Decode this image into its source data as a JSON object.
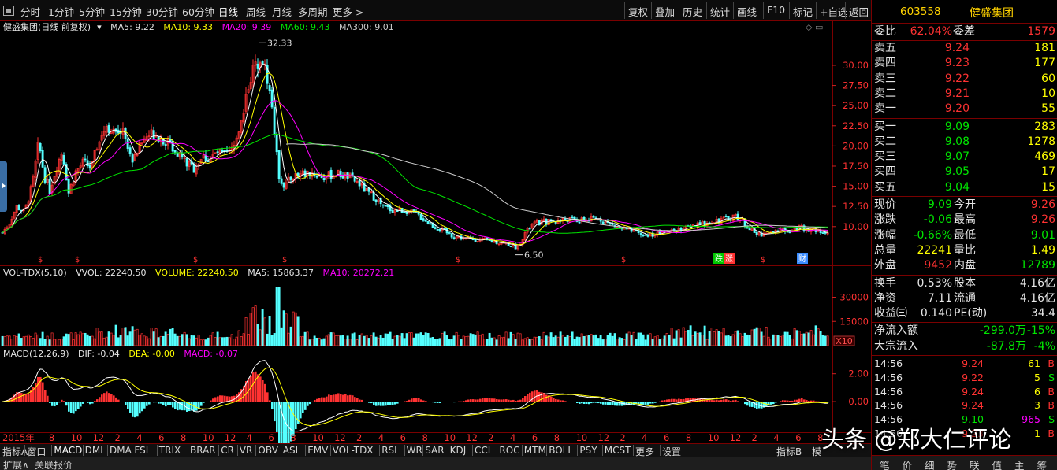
{
  "toolbar": {
    "periods": [
      "分时",
      "1分钟",
      "5分钟",
      "15分钟",
      "30分钟",
      "60分钟",
      "日线",
      "周线",
      "月线",
      "多周期",
      "更多 >"
    ],
    "active_period": "日线",
    "actions": [
      "复权",
      "叠加",
      "历史",
      "统计",
      "画线",
      "F10",
      "标记",
      "+自选",
      "返回"
    ]
  },
  "main_info": {
    "title": "健盛集团(日线 前复权)",
    "ma5": "MA5: 9.22",
    "ma10": "MA10: 9.33",
    "ma20": "MA20: 9.39",
    "ma60": "MA60: 9.43",
    "ma300": "MA300: 9.01"
  },
  "vol_info": {
    "title": "VOL-TDX(5,10)",
    "vvol": "VVOL: 22240.50",
    "volume": "VOLUME: 22240.50",
    "ma5": "MA5: 15863.37",
    "ma10": "MA10: 20272.21"
  },
  "macd_info": {
    "title": "MACD(12,26,9)",
    "dif": "DIF: -0.04",
    "dea": "DEA: -0.00",
    "macd": "MACD: -0.07"
  },
  "colors": {
    "up": "#ff3232",
    "down": "#54ffff",
    "ma5": "#ffffff",
    "ma10": "#ffff00",
    "ma20": "#ff00ff",
    "ma60": "#00e600",
    "ma300": "#cccccc",
    "grid": "#7a0000"
  },
  "chart_data": {
    "type": "candlestick",
    "price_axis": {
      "ticks": [
        30.0,
        27.5,
        25.0,
        22.5,
        20.0,
        17.5,
        15.0,
        12.5,
        10.0
      ],
      "range": [
        5.0,
        34.0
      ]
    },
    "price_annotations": {
      "high": "32.33",
      "low": "6.50"
    },
    "volume_axis": {
      "ticks": [
        30000,
        15000
      ],
      "range": [
        0,
        40000
      ],
      "unit": "X10"
    },
    "macd_axis": {
      "ticks": [
        "2.00",
        "0.00"
      ],
      "range": [
        -2.2,
        3.0
      ]
    },
    "time_labels": [
      "2015年",
      "8",
      "10",
      "12",
      "2",
      "4",
      "6",
      "8",
      "10",
      "12",
      "4",
      "6",
      "8",
      "10",
      "12",
      "2",
      "4",
      "6",
      "8",
      "10",
      "12",
      "2",
      "4",
      "6",
      "8",
      "10",
      "12",
      "2",
      "4",
      "6",
      "8",
      "10",
      "12",
      "2",
      "4",
      "6",
      "8"
    ],
    "markers": [
      "涨",
      "跌",
      "财"
    ],
    "series_points": [
      [
        0,
        9.0
      ],
      [
        10,
        10.3
      ],
      [
        20,
        12.5
      ],
      [
        30,
        11.8
      ],
      [
        40,
        15.2
      ],
      [
        48,
        20.5
      ],
      [
        55,
        16.3
      ],
      [
        62,
        14.5
      ],
      [
        70,
        17.2
      ],
      [
        78,
        19.5
      ],
      [
        86,
        14.2
      ],
      [
        95,
        16.8
      ],
      [
        105,
        18.0
      ],
      [
        115,
        17.2
      ],
      [
        125,
        21.2
      ],
      [
        135,
        22.6
      ],
      [
        145,
        21.3
      ],
      [
        155,
        22.5
      ],
      [
        165,
        18.2
      ],
      [
        175,
        19.8
      ],
      [
        185,
        21.2
      ],
      [
        195,
        21.7
      ],
      [
        205,
        20.9
      ],
      [
        215,
        20.2
      ],
      [
        225,
        19.2
      ],
      [
        235,
        17.9
      ],
      [
        245,
        17.2
      ],
      [
        255,
        18.6
      ],
      [
        265,
        18.4
      ],
      [
        275,
        19.2
      ],
      [
        285,
        18.7
      ],
      [
        295,
        19.6
      ],
      [
        305,
        23.2
      ],
      [
        315,
        28.2
      ],
      [
        325,
        30.4
      ],
      [
        330,
        31.5
      ],
      [
        338,
        28.4
      ],
      [
        345,
        24.2
      ],
      [
        352,
        16.5
      ],
      [
        360,
        15.0
      ],
      [
        370,
        16.2
      ],
      [
        380,
        16.5
      ],
      [
        395,
        16.7
      ],
      [
        410,
        16.1
      ],
      [
        425,
        16.6
      ],
      [
        440,
        16.2
      ],
      [
        455,
        15.3
      ],
      [
        465,
        14.2
      ],
      [
        475,
        13.6
      ],
      [
        485,
        12.4
      ],
      [
        500,
        12.0
      ],
      [
        515,
        12.0
      ],
      [
        530,
        11.4
      ],
      [
        545,
        10.3
      ],
      [
        560,
        9.5
      ],
      [
        575,
        8.8
      ],
      [
        590,
        8.5
      ],
      [
        605,
        8.4
      ],
      [
        620,
        8.2
      ],
      [
        635,
        8.0
      ],
      [
        645,
        7.8
      ],
      [
        655,
        7.4
      ],
      [
        665,
        9.2
      ],
      [
        675,
        10.3
      ],
      [
        690,
        10.6
      ],
      [
        705,
        10.7
      ],
      [
        720,
        10.9
      ],
      [
        735,
        10.7
      ],
      [
        750,
        10.9
      ],
      [
        760,
        11.0
      ],
      [
        770,
        10.4
      ],
      [
        785,
        9.8
      ],
      [
        800,
        9.4
      ],
      [
        815,
        8.9
      ],
      [
        830,
        9.1
      ],
      [
        845,
        9.3
      ],
      [
        860,
        9.6
      ],
      [
        875,
        9.9
      ],
      [
        890,
        10.3
      ],
      [
        905,
        10.8
      ],
      [
        920,
        10.9
      ],
      [
        932,
        11.4
      ],
      [
        945,
        10.3
      ],
      [
        958,
        9.0
      ],
      [
        972,
        9.2
      ],
      [
        985,
        9.5
      ],
      [
        1000,
        9.6
      ],
      [
        1012,
        10.0
      ],
      [
        1025,
        9.6
      ],
      [
        1040,
        9.4
      ],
      [
        1052,
        9.1
      ]
    ]
  },
  "quote": {
    "code": "603558",
    "name": "健盛集团",
    "weibi_label": "委比",
    "weibi": "62.04%",
    "weicha_label": "委差",
    "weicha": "1579",
    "sell": [
      {
        "label": "卖五",
        "price": "9.24",
        "vol": "181"
      },
      {
        "label": "卖四",
        "price": "9.23",
        "vol": "177"
      },
      {
        "label": "卖三",
        "price": "9.22",
        "vol": "60"
      },
      {
        "label": "卖二",
        "price": "9.21",
        "vol": "10"
      },
      {
        "label": "卖一",
        "price": "9.20",
        "vol": "55"
      }
    ],
    "buy": [
      {
        "label": "买一",
        "price": "9.09",
        "vol": "283"
      },
      {
        "label": "买二",
        "price": "9.08",
        "vol": "1278"
      },
      {
        "label": "买三",
        "price": "9.07",
        "vol": "469"
      },
      {
        "label": "买四",
        "price": "9.05",
        "vol": "17"
      },
      {
        "label": "买五",
        "price": "9.04",
        "vol": "15"
      }
    ],
    "stats": [
      {
        "l1": "现价",
        "v1": "9.09",
        "c1": "green",
        "l2": "今开",
        "v2": "9.26",
        "c2": "red"
      },
      {
        "l1": "涨跌",
        "v1": "-0.06",
        "c1": "green",
        "l2": "最高",
        "v2": "9.26",
        "c2": "red"
      },
      {
        "l1": "涨幅",
        "v1": "-0.66%",
        "c1": "green",
        "l2": "最低",
        "v2": "9.01",
        "c2": "green"
      },
      {
        "l1": "总量",
        "v1": "22241",
        "c1": "yellow",
        "l2": "量比",
        "v2": "1.49",
        "c2": "yellow"
      },
      {
        "l1": "外盘",
        "v1": "9452",
        "c1": "red",
        "l2": "内盘",
        "v2": "12789",
        "c2": "green"
      }
    ],
    "stats2": [
      {
        "l1": "换手",
        "v1": "0.53%",
        "l2": "股本",
        "v2": "4.16亿"
      },
      {
        "l1": "净资",
        "v1": "7.11",
        "l2": "流通",
        "v2": "4.16亿"
      },
      {
        "l1": "收益㈢",
        "v1": "0.140",
        "l2": "PE(动)",
        "v2": "34.4"
      }
    ],
    "flow": [
      {
        "label": "净流入额",
        "v1": "-299.0万",
        "v2": "-15%"
      },
      {
        "label": "大宗流入",
        "v1": "-87.8万",
        "v2": "-4%"
      }
    ],
    "ticks": [
      {
        "time": "14:56",
        "price": "9.24",
        "pc": "red",
        "vol": "61",
        "vc": "yellow",
        "side": "B",
        "sc": "red"
      },
      {
        "time": "14:56",
        "price": "9.22",
        "pc": "red",
        "vol": "5",
        "vc": "yellow",
        "side": "S",
        "sc": "green"
      },
      {
        "time": "14:56",
        "price": "9.24",
        "pc": "red",
        "vol": "6",
        "vc": "yellow",
        "side": "B",
        "sc": "red"
      },
      {
        "time": "14:56",
        "price": "9.24",
        "pc": "red",
        "vol": "3",
        "vc": "yellow",
        "side": "B",
        "sc": "red"
      },
      {
        "time": "14:56",
        "price": "9.10",
        "pc": "green",
        "vol": "965",
        "vc": "magenta",
        "side": "S",
        "sc": "green"
      },
      {
        "time": "14:56",
        "price": "9.23",
        "pc": "red",
        "vol": "1",
        "vc": "yellow",
        "side": "B",
        "sc": "red"
      }
    ],
    "panel_tabs": [
      "笔",
      "价",
      "细",
      "势",
      "联",
      "值",
      "主",
      "筹"
    ]
  },
  "indicator_tabs": [
    "指标A",
    "窗口",
    "MACD",
    "DMI",
    "DMA",
    "FSL",
    "TRIX",
    "BRAR",
    "CR",
    "VR",
    "OBV",
    "ASI",
    "EMV",
    "VOL-TDX",
    "RSI",
    "WR",
    "SAR",
    "KDJ",
    "CCI",
    "ROC",
    "MTM",
    "BOLL",
    "PSY",
    "MCST",
    "更多",
    "设置"
  ],
  "indicator_tabs_right": [
    "指标B",
    "模"
  ],
  "ext_tabs": [
    "扩展∧",
    "关联报价"
  ],
  "watermark": "头条 @郑大仁评论"
}
